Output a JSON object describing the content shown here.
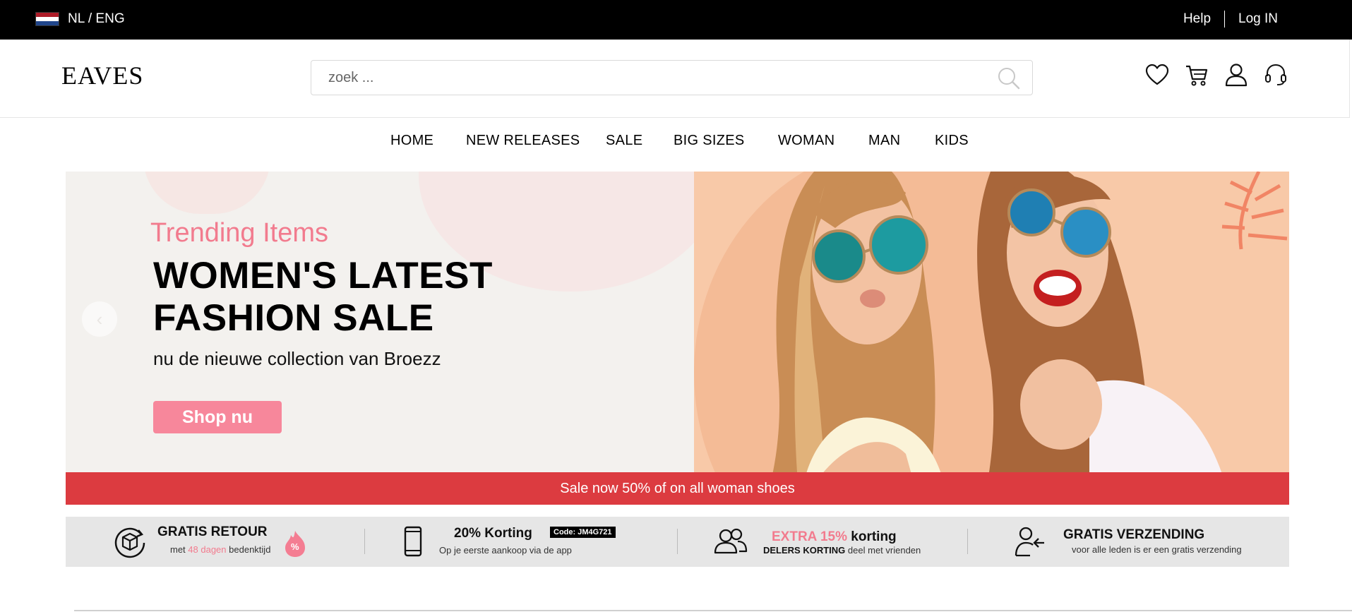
{
  "topbar": {
    "language": "NL / ENG",
    "help_label": "Help",
    "login_label": "Log IN"
  },
  "header": {
    "logo": "EAVES",
    "search_placeholder": "zoek ..."
  },
  "nav": {
    "items": [
      "HOME",
      "NEW RELEASES",
      "SALE",
      "BIG SIZES",
      "WOMAN",
      "MAN",
      "KIDS"
    ]
  },
  "hero": {
    "kicker": "Trending Items",
    "title_line1": "WOMEN'S LATEST",
    "title_line2": "FASHION SALE",
    "subtitle": "nu de nieuwe collection van Broezz",
    "cta": "Shop nu",
    "sale_banner": "Sale now 50% of on all woman shoes"
  },
  "usps": [
    {
      "title": "GRATIS RETOUR",
      "sub_pre": "met",
      "sub_highlight": "48 dagen",
      "sub_post": "bedenktijd",
      "badge": "%"
    },
    {
      "title": "20% Korting",
      "code": "Code: JM4G721",
      "sub": "Op je eerste aankoop via de app"
    },
    {
      "title_highlight": "EXTRA 15%",
      "title_rest": "korting",
      "sub_bold": "DELERS KORTING",
      "sub": "deel met vrienden"
    },
    {
      "title": "GRATIS VERZENDING",
      "sub": "voor alle leden is er een gratis verzending"
    }
  ],
  "colors": {
    "accent_pink": "#f27b8e",
    "sale_red": "#dc3b40",
    "topbar": "#000000"
  },
  "icons": [
    "flag-nl-icon",
    "search-icon",
    "heart-icon",
    "cart-icon",
    "user-icon",
    "headset-icon",
    "return-box-icon",
    "phone-icon",
    "friends-icon",
    "user-arrow-icon",
    "flame-percent-icon",
    "chevron-left-icon"
  ]
}
